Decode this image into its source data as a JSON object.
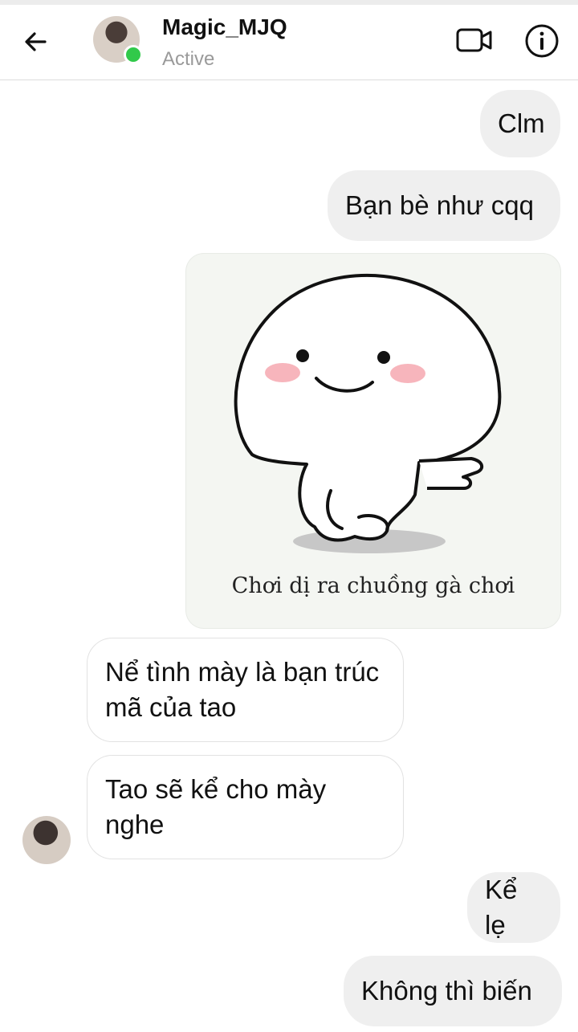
{
  "header": {
    "contact_name": "Magic_MJQ",
    "status": "Active",
    "icons": {
      "back": "back-arrow-icon",
      "video": "video-call-icon",
      "info": "info-icon"
    },
    "colors": {
      "online": "#31c94a",
      "status_text": "#9a9a9a"
    }
  },
  "messages": [
    {
      "side": "outgoing",
      "text": "Clm"
    },
    {
      "side": "outgoing",
      "text": "Bạn bè như cqq"
    },
    {
      "side": "outgoing",
      "type": "sticker",
      "caption": "Chơi dị ra chuồng gà chơi"
    },
    {
      "side": "incoming",
      "text": "Nể tình mày là bạn trúc mã của tao"
    },
    {
      "side": "incoming",
      "text": "Tao sẽ kể cho mày nghe"
    },
    {
      "side": "outgoing",
      "text": "Kể lẹ"
    },
    {
      "side": "outgoing",
      "text": "Không thì biến"
    }
  ],
  "colors": {
    "outgoing_bubble": "#efefef",
    "incoming_bubble": "#ffffff",
    "incoming_border": "#e2e2e2"
  }
}
